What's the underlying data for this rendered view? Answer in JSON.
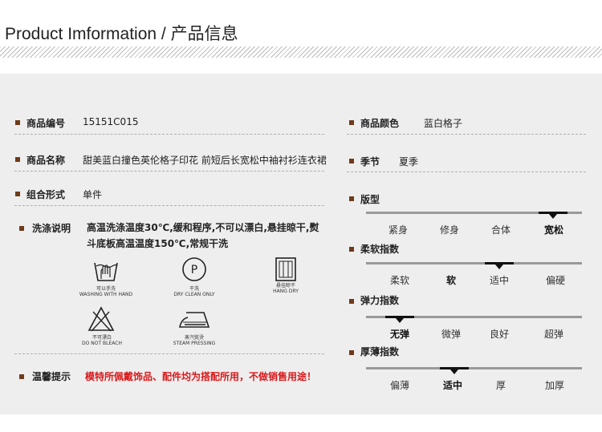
{
  "header": {
    "title": "Product Imformation / 产品信息"
  },
  "left": {
    "code": {
      "label": "商品编号",
      "value": "15151C015"
    },
    "name": {
      "label": "商品名称",
      "value": "甜美蓝白撞色英伦格子印花 前短后长宽松中袖衬衫连衣裙"
    },
    "style": {
      "label": "组合形式",
      "value": "单件"
    },
    "wash": {
      "label": "洗涤说明",
      "text": "高温洗涤温度30℃,缓和程序,不可以漂白,悬挂晾干,熨斗底板高温温度150℃,常规干洗",
      "icons": [
        {
          "icon": "hand-wash-icon",
          "zh": "可以手洗",
          "en": "WASHING WITH HAND"
        },
        {
          "icon": "dry-clean-icon",
          "zh": "干洗",
          "en": "DRY CLEAN ONLY"
        },
        {
          "icon": "hang-dry-icon",
          "zh": "悬挂晾干",
          "en": "HANG DRY"
        },
        {
          "icon": "no-bleach-icon",
          "zh": "不可漂白",
          "en": "DO NOT BLEACH"
        },
        {
          "icon": "steam-iron-icon",
          "zh": "蒸汽熨烫",
          "en": "STEAM PRESSING"
        }
      ],
      "dry_clean_letter": "P"
    },
    "warm": {
      "label": "温馨提示",
      "text": "模特所佩戴饰品、配件均为搭配所用，不做销售用途！",
      "color": "#d9191b"
    }
  },
  "right": {
    "color": {
      "label": "商品颜色",
      "value": "蓝白格子"
    },
    "season": {
      "label": "季节",
      "value": "夏季"
    },
    "scales": [
      {
        "label": "版型",
        "options": [
          "紧身",
          "修身",
          "合体",
          "宽松"
        ],
        "selected": 3
      },
      {
        "label": "柔软指数",
        "options": [
          "柔软",
          "软",
          "适中",
          "偏硬"
        ],
        "selected": 2
      },
      {
        "label": "弹力指数",
        "options": [
          "无弹",
          "微弹",
          "良好",
          "超弹"
        ],
        "selected": 0
      },
      {
        "label": "厚薄指数",
        "options": [
          "偏薄",
          "适中",
          "厚",
          "加厚"
        ],
        "selected": 1
      }
    ]
  },
  "colors": {
    "bullet": "#6e3b1a",
    "panel": "#eeeeee",
    "warning": "#d9191b"
  }
}
